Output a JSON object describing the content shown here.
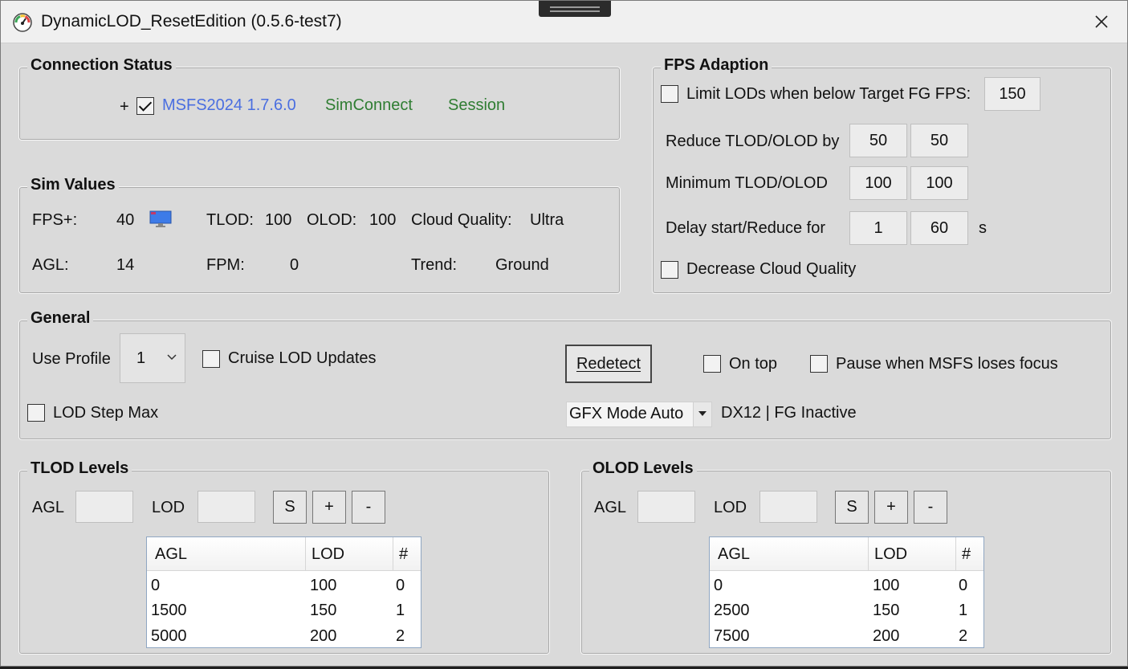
{
  "window": {
    "title": "DynamicLOD_ResetEdition (0.5.6-test7)"
  },
  "connection": {
    "legend": "Connection Status",
    "prefix": "+",
    "sim_checked": true,
    "sim_version": "MSFS2024 1.7.6.0",
    "simconnect": "SimConnect",
    "session": "Session",
    "colors": {
      "sim_version": "#4a6ee0",
      "ok": "#2f7d32"
    }
  },
  "sim_values": {
    "legend": "Sim Values",
    "fps_label": "FPS+:",
    "fps_value": "40",
    "tlod_label": "TLOD:",
    "tlod_value": "100",
    "olod_label": "OLOD:",
    "olod_value": "100",
    "cloud_label": "Cloud Quality:",
    "cloud_value": "Ultra",
    "agl_label": "AGL:",
    "agl_value": "14",
    "fpm_label": "FPM:",
    "fpm_value": "0",
    "trend_label": "Trend:",
    "trend_value": "Ground"
  },
  "fps_adaption": {
    "legend": "FPS Adaption",
    "limit_label": "Limit LODs when below Target FG FPS:",
    "limit_checked": false,
    "target_fps": "150",
    "reduce_label": "Reduce TLOD/OLOD by",
    "reduce_tlod": "50",
    "reduce_olod": "50",
    "minimum_label": "Minimum TLOD/OLOD",
    "minimum_tlod": "100",
    "minimum_olod": "100",
    "delay_label": "Delay start/Reduce for",
    "delay_start": "1",
    "reduce_for": "60",
    "seconds_unit": "s",
    "decrease_cloud_label": "Decrease Cloud Quality",
    "decrease_cloud_checked": false
  },
  "general": {
    "legend": "General",
    "use_profile_label": "Use Profile",
    "profile_value": "1",
    "cruise_label": "Cruise LOD Updates",
    "redetect_label": "Redetect",
    "on_top_label": "On top",
    "pause_label": "Pause when MSFS loses focus",
    "lod_step_label": "LOD Step Max",
    "gfx_mode": "GFX Mode Auto",
    "gfx_status": "DX12 | FG Inactive"
  },
  "tlod_levels": {
    "legend": "TLOD Levels",
    "agl_label": "AGL",
    "lod_label": "LOD",
    "s_label": "S",
    "plus_label": "+",
    "minus_label": "-",
    "columns": [
      "AGL",
      "LOD",
      "#"
    ],
    "rows": [
      {
        "agl": "0",
        "lod": "100",
        "idx": "0"
      },
      {
        "agl": "1500",
        "lod": "150",
        "idx": "1"
      },
      {
        "agl": "5000",
        "lod": "200",
        "idx": "2"
      }
    ]
  },
  "olod_levels": {
    "legend": "OLOD Levels",
    "agl_label": "AGL",
    "lod_label": "LOD",
    "s_label": "S",
    "plus_label": "+",
    "minus_label": "-",
    "columns": [
      "AGL",
      "LOD",
      "#"
    ],
    "rows": [
      {
        "agl": "0",
        "lod": "100",
        "idx": "0"
      },
      {
        "agl": "2500",
        "lod": "150",
        "idx": "1"
      },
      {
        "agl": "7500",
        "lod": "200",
        "idx": "2"
      }
    ]
  }
}
